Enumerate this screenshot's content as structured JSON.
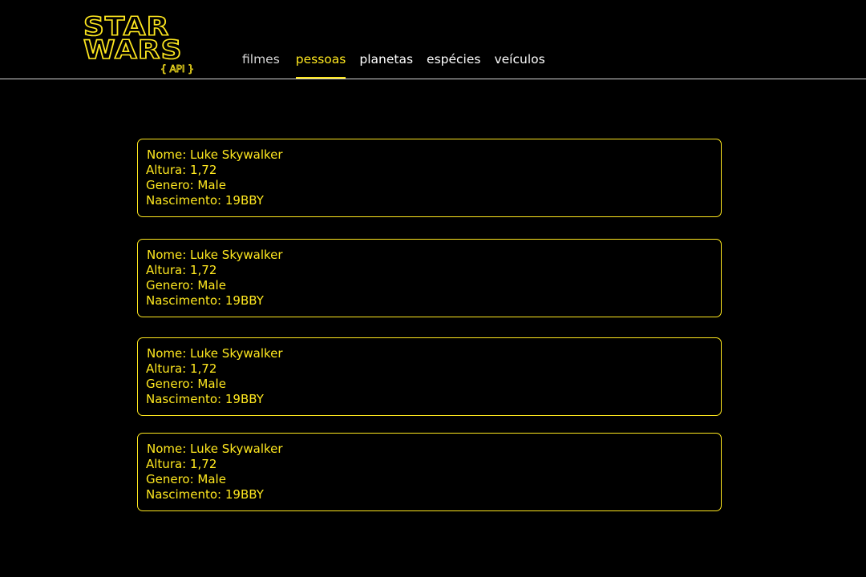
{
  "logo": {
    "line1": "STAR",
    "line2": "WARS",
    "subtitle": "{ API }"
  },
  "nav": {
    "items": [
      {
        "label": "filmes"
      },
      {
        "label": "pessoas"
      },
      {
        "label": "planetas"
      },
      {
        "label": "espécies"
      },
      {
        "label": "veículos"
      }
    ],
    "active": "pessoas"
  },
  "cards": [
    {
      "nome": "Nome: Luke Skywalker",
      "altura": "Altura: 1,72",
      "genero": "Genero: Male",
      "nascimento": "Nascimento: 19BBY"
    },
    {
      "nome": "Nome: Luke Skywalker",
      "altura": "Altura: 1,72",
      "genero": "Genero: Male",
      "nascimento": "Nascimento: 19BBY"
    },
    {
      "nome": "Nome: Luke Skywalker",
      "altura": "Altura: 1,72",
      "genero": "Genero: Male",
      "nascimento": "Nascimento: 19BBY"
    },
    {
      "nome": "Nome: Luke Skywalker",
      "altura": "Altura: 1,72",
      "genero": "Genero: Male",
      "nascimento": "Nascimento: 19BBY"
    }
  ],
  "colors": {
    "background": "#000000",
    "accent": "#ffe81f",
    "nav_text": "#ffffff",
    "divider": "#d8d8d8"
  }
}
